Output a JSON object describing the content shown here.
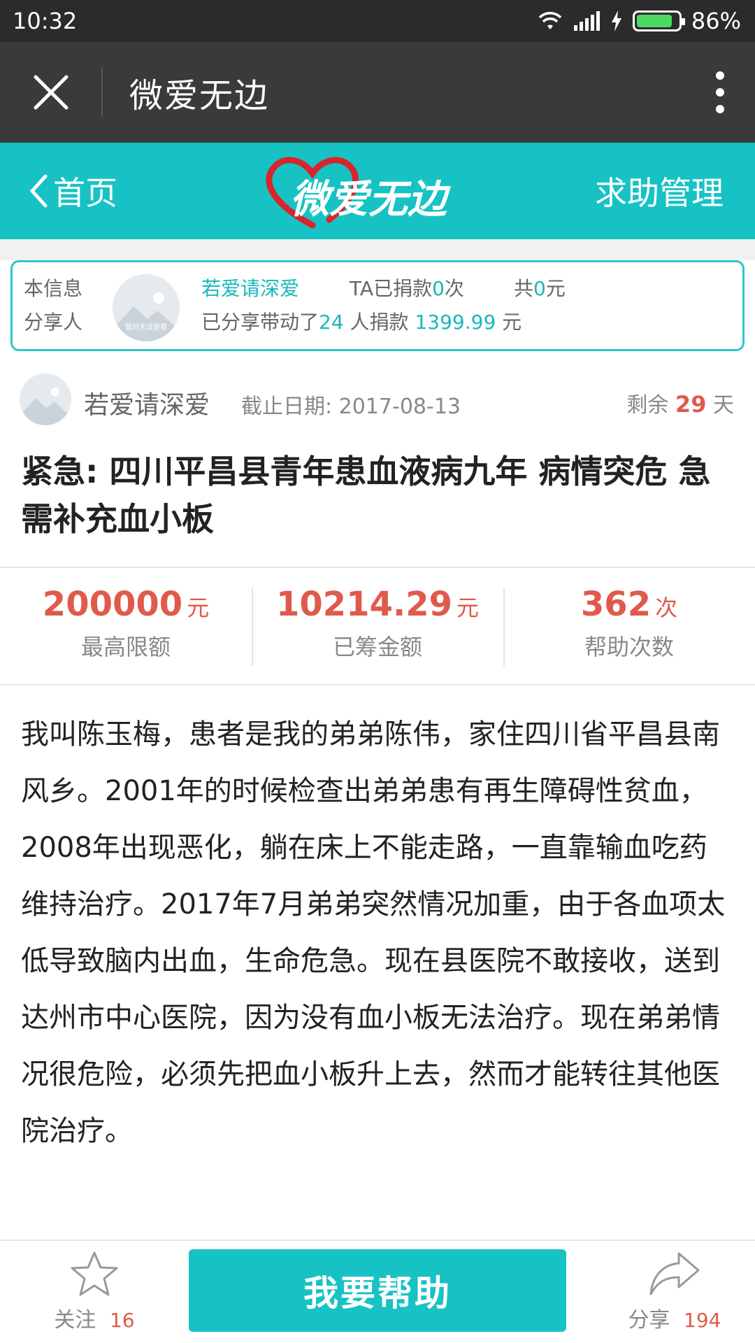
{
  "status_bar": {
    "time": "10:32",
    "battery": "86%",
    "battery_level": 0.86
  },
  "titlebar": {
    "title": "微爱无边",
    "close_icon": "close-icon",
    "more_icon": "more-vertical-icon"
  },
  "site_header": {
    "back_label": "首页",
    "logo_text": "微爱无边",
    "manage_label": "求助管理"
  },
  "sharer": {
    "label_line1": "本信息",
    "label_line2": "分享人",
    "avatar_text": "暂时无法查看",
    "name": "若爱请深爱",
    "donated_prefix": "TA已捐款",
    "donated_count": "0",
    "donated_suffix": "次",
    "total_prefix": "共",
    "total_amount": "0",
    "total_suffix": "元",
    "shared_prefix": "已分享带动了",
    "shared_people": "24",
    "shared_middle": " 人捐款 ",
    "shared_amount": "1399.99",
    "shared_suffix": " 元"
  },
  "post": {
    "author": "若爱请深爱",
    "deadline": "截止日期: 2017-08-13",
    "remain_prefix": "剩余",
    "remain_days": "29",
    "remain_suffix": "天",
    "title": "紧急: 四川平昌县青年患血液病九年 病情突危 急需补充血小板"
  },
  "stats": [
    {
      "value": "200000",
      "unit": "元",
      "label": "最高限额"
    },
    {
      "value": "10214.29",
      "unit": "元",
      "label": "已筹金额"
    },
    {
      "value": "362",
      "unit": "次",
      "label": "帮助次数"
    }
  ],
  "story": "我叫陈玉梅，患者是我的弟弟陈伟，家住四川省平昌县南风乡。2001年的时候检查出弟弟患有再生障碍性贫血，2008年出现恶化，躺在床上不能走路，一直靠输血吃药维持治疗。2017年7月弟弟突然情况加重，由于各血项太低导致脑内出血，生命危急。现在县医院不敢接收，送到达州市中心医院，因为没有血小板无法治疗。现在弟弟情况很危险，必须先把血小板升上去，然而才能转往其他医院治疗。",
  "bottom_bar": {
    "follow_label": "关注",
    "follow_count": "16",
    "help_label": "我要帮助",
    "share_label": "分享",
    "share_count": "194"
  },
  "colors": {
    "teal": "#17c2c4",
    "red": "#e05a4c",
    "battery_green": "#4cd964",
    "logo_red": "#d7262b"
  }
}
